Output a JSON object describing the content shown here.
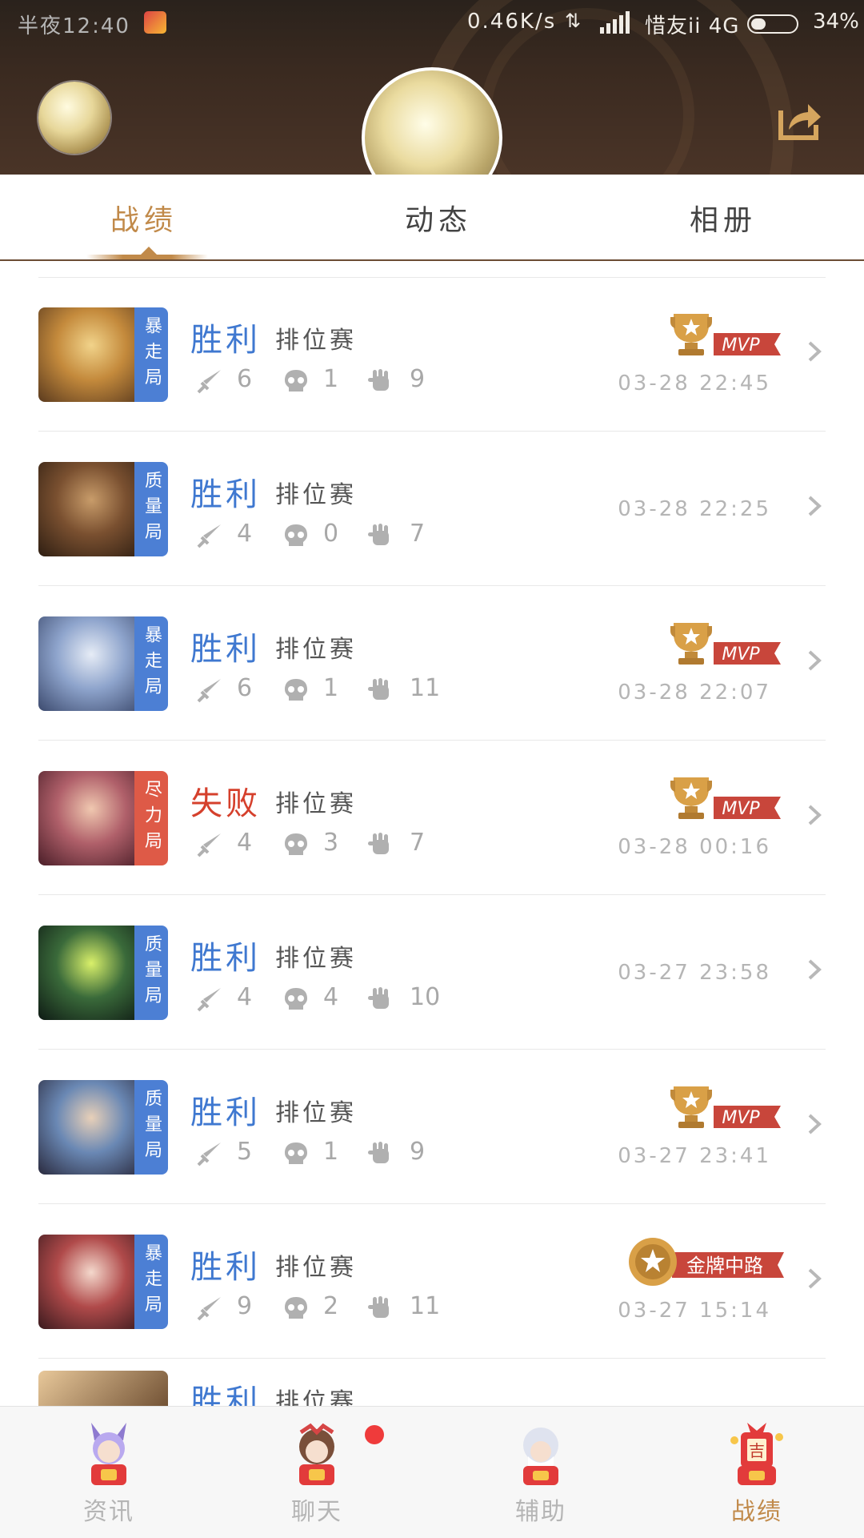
{
  "status_bar": {
    "time": "半夜12:40",
    "net_speed": "0.46K/s",
    "carrier": "惜友ii 4G",
    "battery": "34%",
    "battery_level": 0.34
  },
  "tabs": [
    {
      "label": "战绩",
      "active": true
    },
    {
      "label": "动态",
      "active": false
    },
    {
      "label": "相册",
      "active": false
    }
  ],
  "records": [
    {
      "tag": "暴走局",
      "tag_color": "#4c7fd4",
      "result": "胜利",
      "win": true,
      "mode": "排位赛",
      "kills": "6",
      "deaths": "1",
      "assists": "9",
      "time": "03-28 22:45",
      "badge": "MVP",
      "hero_colors": [
        "#f1d38a",
        "#c48a3c",
        "#5a3a1e"
      ]
    },
    {
      "tag": "质量局",
      "tag_color": "#4c7fd4",
      "result": "胜利",
      "win": true,
      "mode": "排位赛",
      "kills": "4",
      "deaths": "0",
      "assists": "7",
      "time": "03-28 22:25",
      "badge": "",
      "hero_colors": [
        "#c89c6a",
        "#7a5030",
        "#2e1e12"
      ]
    },
    {
      "tag": "暴走局",
      "tag_color": "#4c7fd4",
      "result": "胜利",
      "win": true,
      "mode": "排位赛",
      "kills": "6",
      "deaths": "1",
      "assists": "11",
      "time": "03-28 22:07",
      "badge": "MVP",
      "hero_colors": [
        "#e6ecf6",
        "#8ea4cc",
        "#3c4a6e"
      ]
    },
    {
      "tag": "尽力局",
      "tag_color": "#de5a47",
      "result": "失败",
      "win": false,
      "mode": "排位赛",
      "kills": "4",
      "deaths": "3",
      "assists": "7",
      "time": "03-28 00:16",
      "badge": "MVP",
      "hero_colors": [
        "#f0c8b0",
        "#b0606a",
        "#4a1e28"
      ]
    },
    {
      "tag": "质量局",
      "tag_color": "#4c7fd4",
      "result": "胜利",
      "win": true,
      "mode": "排位赛",
      "kills": "4",
      "deaths": "4",
      "assists": "10",
      "time": "03-27 23:58",
      "badge": "",
      "hero_colors": [
        "#d9f06a",
        "#3a6a3a",
        "#0e1a14"
      ]
    },
    {
      "tag": "质量局",
      "tag_color": "#4c7fd4",
      "result": "胜利",
      "win": true,
      "mode": "排位赛",
      "kills": "5",
      "deaths": "1",
      "assists": "9",
      "time": "03-27 23:41",
      "badge": "MVP",
      "hero_colors": [
        "#e8d0b8",
        "#6a88b4",
        "#2a2a3e"
      ]
    },
    {
      "tag": "暴走局",
      "tag_color": "#4c7fd4",
      "result": "胜利",
      "win": true,
      "mode": "排位赛",
      "kills": "9",
      "deaths": "2",
      "assists": "11",
      "time": "03-27 15:14",
      "badge": "金牌中路",
      "hero_colors": [
        "#f4d8cc",
        "#b04a4a",
        "#3a1a1e"
      ]
    }
  ],
  "partial_record": {
    "result": "胜利",
    "mode": "排位赛"
  },
  "badges": {
    "mvp": "MVP",
    "gold_mid": "金牌中路"
  },
  "bottom_nav": [
    {
      "label": "资讯",
      "active": false,
      "icon": "news-mascot-icon"
    },
    {
      "label": "聊天",
      "active": false,
      "icon": "chat-mascot-icon",
      "notification": true
    },
    {
      "label": "辅助",
      "active": false,
      "icon": "assist-mascot-icon"
    },
    {
      "label": "战绩",
      "active": true,
      "icon": "record-mascot-icon"
    }
  ],
  "colors": {
    "accent": "#c18a4a",
    "win": "#3f78d0",
    "lose": "#d5402c",
    "tag_blue": "#4c7fd4",
    "tag_red": "#de5a47"
  }
}
